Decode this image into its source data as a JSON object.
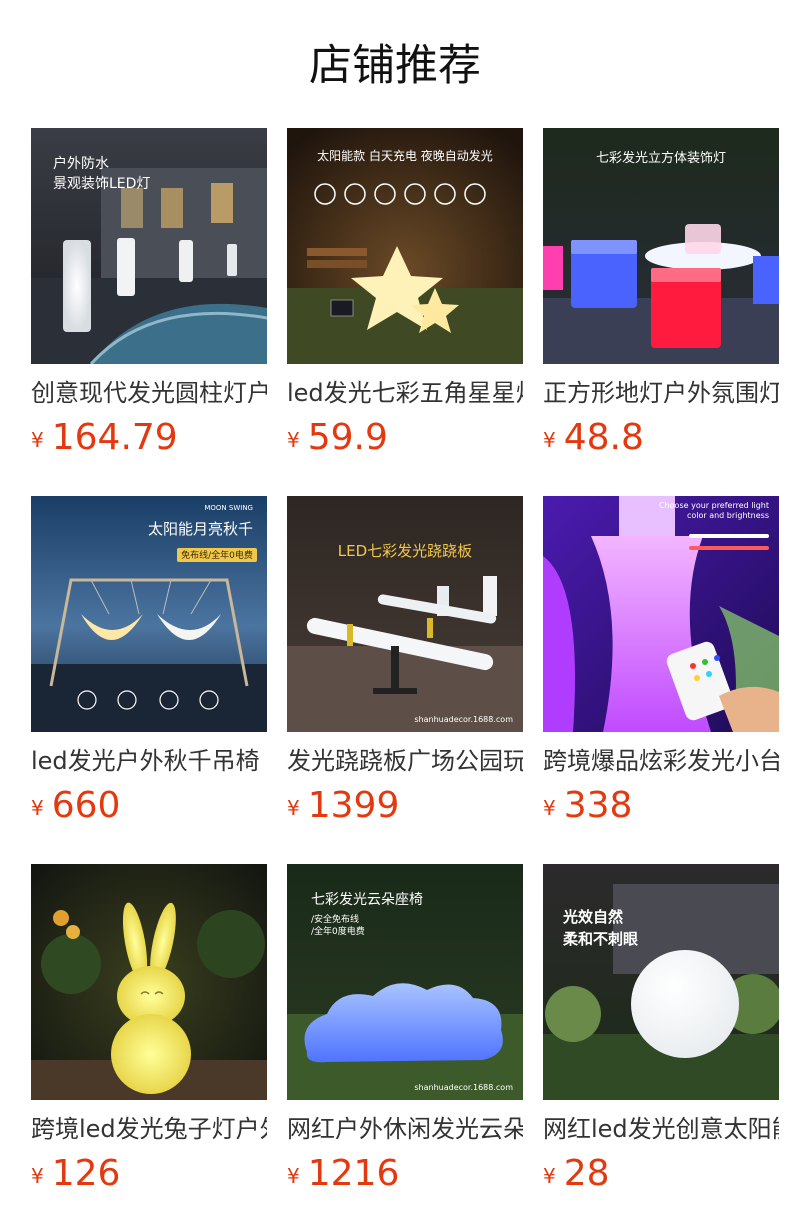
{
  "header": {
    "title": "店铺推荐"
  },
  "currency_symbol": "¥",
  "products": [
    {
      "name": "创意现代发光圆柱灯户外",
      "price": "164.79",
      "image_icon": "glowing-cylinder-lamp-image",
      "image_text": [
        "户外防水",
        "景观装饰LED灯"
      ]
    },
    {
      "name": "led发光七彩五角星星灯",
      "price": "59.9",
      "image_icon": "glowing-star-lamp-image",
      "image_text": [
        "太阳能款 白天充电 夜晚自动发光"
      ]
    },
    {
      "name": "正方形地灯户外氛围灯",
      "price": "48.8",
      "image_icon": "glowing-cube-lamp-image",
      "image_text": [
        "七彩发光立方体装饰灯"
      ]
    },
    {
      "name": "led发光户外秋千吊椅",
      "price": "660",
      "image_icon": "moon-swing-image",
      "image_text": [
        "MOON SWING",
        "太阳能月亮秋千",
        "免布线/全年0电费"
      ]
    },
    {
      "name": "发光跷跷板广场公园玩具",
      "price": "1399",
      "image_icon": "glowing-seesaw-image",
      "image_text": [
        "LED七彩发光跷跷板",
        "shanhuadecor.1688.com"
      ]
    },
    {
      "name": "跨境爆品炫彩发光小台灯",
      "price": "338",
      "image_icon": "glowing-vase-remote-image",
      "image_text": [
        "Choose your preferred light",
        "color and brightness"
      ]
    },
    {
      "name": "跨境led发光兔子灯户外",
      "price": "126",
      "image_icon": "glowing-rabbit-lamp-image",
      "image_text": []
    },
    {
      "name": "网红户外休闲发光云朵座椅",
      "price": "1216",
      "image_icon": "glowing-cloud-seat-image",
      "image_text": [
        "七彩发光云朵座椅",
        "/安全免布线",
        "/全年0度电费",
        "shanhuadecor.1688.com"
      ]
    },
    {
      "name": "网红led发光创意太阳能球",
      "price": "28",
      "image_icon": "glowing-ball-lamp-image",
      "image_text": [
        "光效自然",
        "柔和不刺眼"
      ]
    }
  ]
}
